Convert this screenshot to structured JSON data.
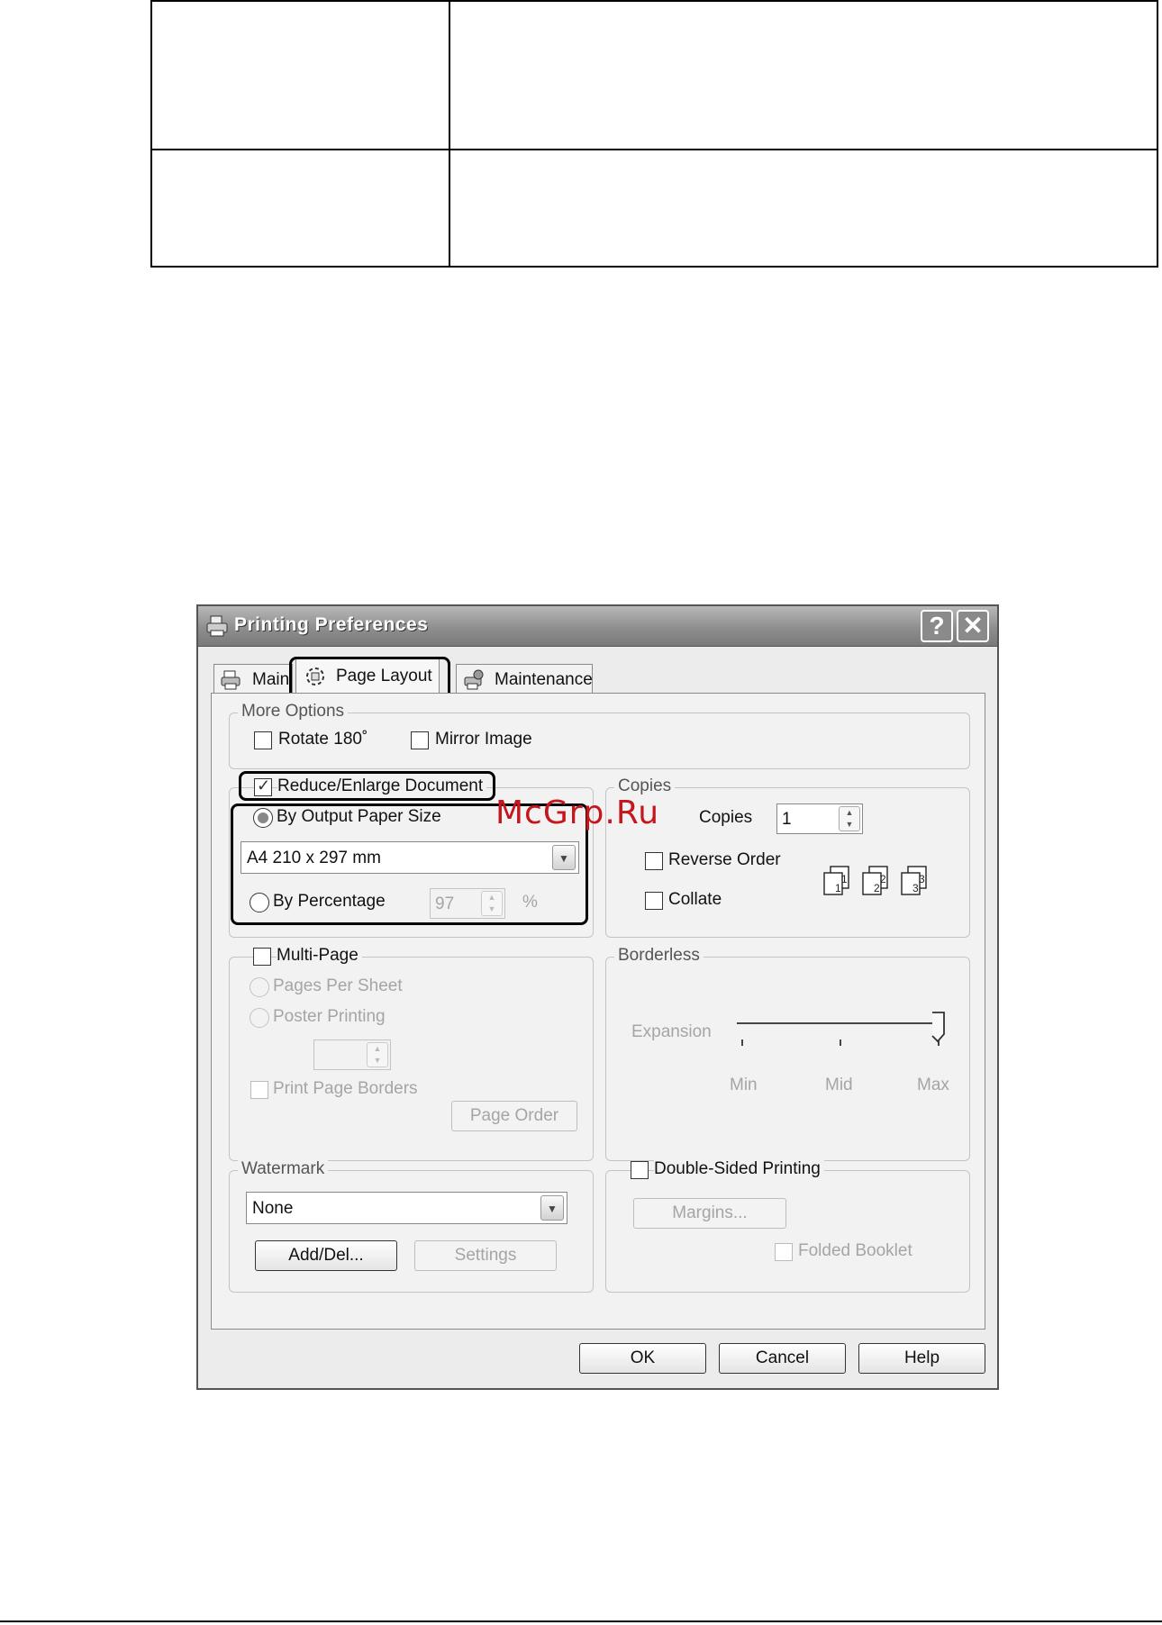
{
  "document": {
    "table_rows": [
      {
        "left": "",
        "right": ""
      },
      {
        "left": "",
        "right": ""
      }
    ]
  },
  "dialog": {
    "title": "Printing Preferences",
    "help_symbol": "?",
    "close_symbol": "✕",
    "tabs": [
      {
        "label": "Main",
        "icon": "printer-icon"
      },
      {
        "label": "Page Layout",
        "icon": "page-layout-icon",
        "selected": true
      },
      {
        "label": "Maintenance",
        "icon": "maintenance-icon"
      }
    ],
    "more_options": {
      "label": "More Options",
      "rotate_label": "Rotate 180˚",
      "mirror_label": "Mirror Image"
    },
    "reduce_enlarge": {
      "label": "Reduce/Enlarge Document",
      "checked": true,
      "by_output_label": "By Output Paper Size",
      "paper_size": "A4 210 x 297 mm",
      "by_percentage_label": "By Percentage",
      "percentage_value": "97",
      "percent_sign": "%"
    },
    "copies": {
      "label": "Copies",
      "copies_label": "Copies",
      "copies_value": "1",
      "reverse_label": "Reverse Order",
      "collate_label": "Collate",
      "collate_numbers": [
        "1",
        "1",
        "2",
        "2",
        "3",
        "3"
      ]
    },
    "multi_page": {
      "label": "Multi-Page",
      "pages_per_sheet_label": "Pages Per Sheet",
      "poster_label": "Poster Printing",
      "print_borders_label": "Print Page Borders",
      "page_order_label": "Page Order"
    },
    "borderless": {
      "label": "Borderless",
      "expansion_label": "Expansion",
      "min_label": "Min",
      "mid_label": "Mid",
      "max_label": "Max",
      "level": "Max"
    },
    "watermark": {
      "label": "Watermark",
      "value": "None",
      "add_del_label": "Add/Del...",
      "settings_label": "Settings"
    },
    "double_sided": {
      "label": "Double-Sided Printing",
      "margins_label": "Margins...",
      "folded_label": "Folded Booklet"
    },
    "footer": {
      "ok_label": "OK",
      "cancel_label": "Cancel",
      "help_label": "Help"
    }
  },
  "overlay_text": "McGrp.Ru",
  "colors": {
    "overlay_red": "#c4161c",
    "titlebar_grey": "#8e8e8e",
    "dialog_bg": "#ececec"
  }
}
